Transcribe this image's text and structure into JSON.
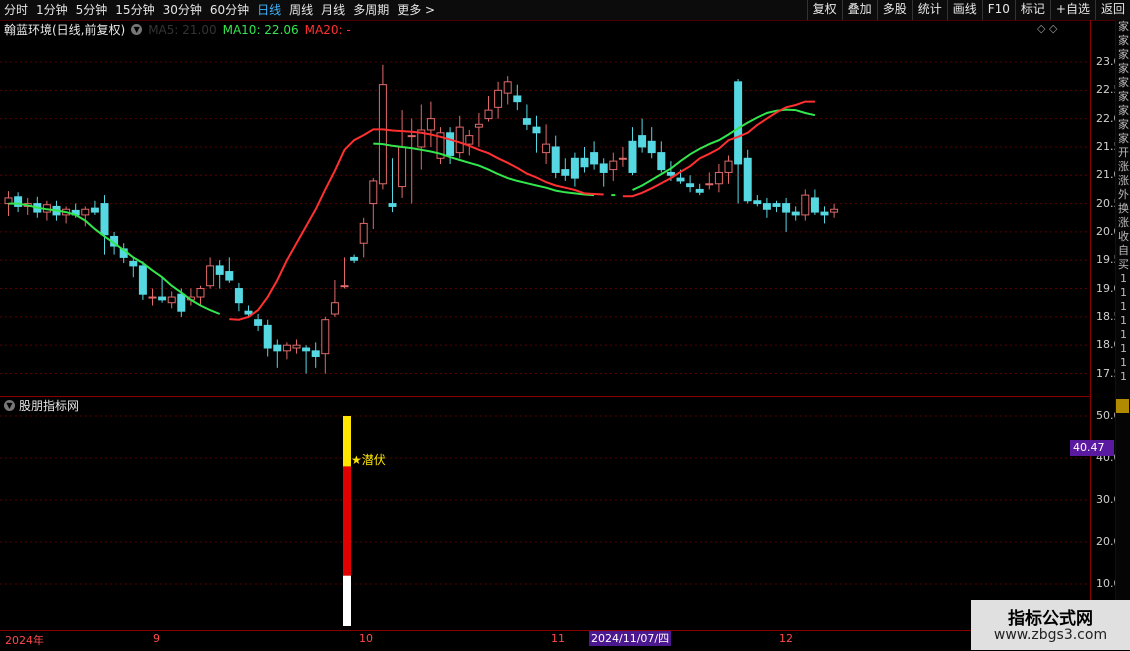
{
  "toolbar": {
    "tabs": [
      "分时",
      "1分钟",
      "5分钟",
      "15分钟",
      "30分钟",
      "60分钟",
      "日线",
      "周线",
      "月线",
      "多周期",
      "更多 >"
    ],
    "active_tab": "日线",
    "right_buttons": [
      "复权",
      "叠加",
      "多股",
      "统计",
      "画线",
      "F10",
      "标记",
      "+自选",
      "返回"
    ]
  },
  "header": {
    "stock_name": "翰蓝环境(日线,前复权)",
    "ma10_label": "MA10: 22.06",
    "ma20_label": "MA20: -",
    "faint_label": "MA5: 21.00"
  },
  "colors": {
    "up": "#e06a6a",
    "down": "#56d8e2",
    "ma10": "#33e64d",
    "ma20": "#ff3030",
    "grid": "#5a0000",
    "axis": "#8a0000",
    "signal": "#ffe600"
  },
  "price_axis": {
    "ticks": [
      "23.00",
      "22.50",
      "22.00",
      "21.50",
      "21.00",
      "20.50",
      "20.00",
      "19.50",
      "19.00",
      "18.50",
      "18.00",
      "17.50"
    ],
    "min": 17.25,
    "max": 23.1
  },
  "indicator": {
    "title": "股朋指标网",
    "ticks": [
      "50.00",
      "40.00",
      "30.00",
      "20.00",
      "10.00"
    ],
    "current_value": "40.47",
    "signal_label": "★潜伏",
    "signal_bar": {
      "segments": [
        {
          "color": "#ffffff",
          "from": 0,
          "to": 12
        },
        {
          "color": "#e00000",
          "from": 12,
          "to": 38
        },
        {
          "color": "#ffe600",
          "from": 38,
          "to": 50
        }
      ]
    }
  },
  "xaxis": {
    "labels": [
      "2024年",
      "9",
      "10",
      "11",
      "12"
    ],
    "cursor_date": "2024/11/07/四"
  },
  "right_strip": [
    "家",
    "家",
    "家",
    "家",
    "家",
    "家",
    "家",
    "家",
    "家",
    "开",
    "涨",
    "涨",
    "外",
    "换",
    "涨",
    "收",
    "自",
    "买",
    "1",
    "1",
    "1",
    "1",
    "1",
    "1",
    "1",
    "1"
  ],
  "watermark": {
    "line1": "指标公式网",
    "line2": "www.zbgs3.com"
  },
  "chart_data": {
    "type": "candlestick",
    "title": "翰蓝环境(日线,前复权)",
    "ylim": [
      17.25,
      23.1
    ],
    "series": [
      {
        "name": "MA10",
        "values": [
          20.5,
          20.5,
          20.47,
          20.43,
          20.4,
          20.38,
          20.35,
          20.3,
          20.2,
          20.05,
          19.92,
          19.8,
          19.68,
          19.55,
          19.45,
          19.32,
          19.2,
          19.05,
          18.93,
          18.8,
          18.7,
          18.62,
          18.55,
          null,
          null,
          null,
          null,
          null,
          null,
          null,
          null,
          null,
          null,
          null,
          null,
          null,
          null,
          null,
          21.56,
          21.55,
          21.52,
          21.5,
          21.48,
          21.45,
          21.42,
          21.38,
          21.32,
          21.27,
          21.22,
          21.17,
          21.1,
          21.02,
          20.95,
          20.9,
          20.86,
          20.82,
          20.78,
          20.73,
          20.7,
          20.68,
          20.66,
          20.65,
          null,
          20.65,
          null,
          20.74,
          20.82,
          20.92,
          21.02,
          21.12,
          21.25,
          21.37,
          21.47,
          21.55,
          21.62,
          21.72,
          21.83,
          21.93,
          22.02,
          22.1,
          22.14,
          22.16,
          22.15,
          22.1,
          22.06
        ]
      },
      {
        "name": "MA20",
        "values": [
          null,
          null,
          null,
          null,
          null,
          null,
          null,
          null,
          null,
          null,
          null,
          null,
          null,
          null,
          null,
          null,
          null,
          null,
          null,
          null,
          null,
          null,
          null,
          18.46,
          18.45,
          18.5,
          18.62,
          18.85,
          19.15,
          19.5,
          19.8,
          20.1,
          20.4,
          20.75,
          21.08,
          21.45,
          21.62,
          21.71,
          21.81,
          21.81,
          21.79,
          21.78,
          21.77,
          21.75,
          21.72,
          21.68,
          21.63,
          21.58,
          21.52,
          21.45,
          21.39,
          21.3,
          21.22,
          21.13,
          21.03,
          20.96,
          20.88,
          20.82,
          20.78,
          20.74,
          20.68,
          20.67,
          20.66,
          null,
          20.63,
          20.63,
          20.69,
          20.77,
          20.86,
          20.95,
          21.06,
          21.16,
          21.3,
          21.38,
          21.47,
          21.62,
          21.68,
          21.75,
          21.89,
          22.0,
          22.11,
          22.2,
          22.24,
          22.3,
          22.3,
          null
        ]
      }
    ],
    "candles": [
      {
        "o": 20.5,
        "h": 20.72,
        "l": 20.28,
        "c": 20.6
      },
      {
        "o": 20.62,
        "h": 20.7,
        "l": 20.35,
        "c": 20.45
      },
      {
        "o": 20.45,
        "h": 20.6,
        "l": 20.3,
        "c": 20.5
      },
      {
        "o": 20.5,
        "h": 20.62,
        "l": 20.25,
        "c": 20.35
      },
      {
        "o": 20.35,
        "h": 20.55,
        "l": 20.2,
        "c": 20.48
      },
      {
        "o": 20.45,
        "h": 20.55,
        "l": 20.2,
        "c": 20.3
      },
      {
        "o": 20.3,
        "h": 20.45,
        "l": 20.15,
        "c": 20.4
      },
      {
        "o": 20.38,
        "h": 20.5,
        "l": 20.25,
        "c": 20.3
      },
      {
        "o": 20.3,
        "h": 20.45,
        "l": 20.1,
        "c": 20.4
      },
      {
        "o": 20.42,
        "h": 20.55,
        "l": 20.3,
        "c": 20.35
      },
      {
        "o": 20.5,
        "h": 20.65,
        "l": 19.6,
        "c": 19.95
      },
      {
        "o": 19.92,
        "h": 20.0,
        "l": 19.6,
        "c": 19.75
      },
      {
        "o": 19.7,
        "h": 19.8,
        "l": 19.45,
        "c": 19.55
      },
      {
        "o": 19.48,
        "h": 19.55,
        "l": 19.2,
        "c": 19.4
      },
      {
        "o": 19.4,
        "h": 19.48,
        "l": 18.8,
        "c": 18.9
      },
      {
        "o": 18.85,
        "h": 19.0,
        "l": 18.7,
        "c": 18.85
      },
      {
        "o": 18.85,
        "h": 19.2,
        "l": 18.75,
        "c": 18.8
      },
      {
        "o": 18.75,
        "h": 18.95,
        "l": 18.65,
        "c": 18.85
      },
      {
        "o": 18.9,
        "h": 19.0,
        "l": 18.5,
        "c": 18.6
      },
      {
        "o": 18.8,
        "h": 19.0,
        "l": 18.7,
        "c": 18.85
      },
      {
        "o": 18.85,
        "h": 19.05,
        "l": 18.7,
        "c": 19.0
      },
      {
        "o": 19.05,
        "h": 19.55,
        "l": 19.0,
        "c": 19.4
      },
      {
        "o": 19.4,
        "h": 19.5,
        "l": 19.0,
        "c": 19.25
      },
      {
        "o": 19.3,
        "h": 19.55,
        "l": 19.1,
        "c": 19.15
      },
      {
        "o": 19.0,
        "h": 19.1,
        "l": 18.6,
        "c": 18.75
      },
      {
        "o": 18.6,
        "h": 18.7,
        "l": 18.5,
        "c": 18.55
      },
      {
        "o": 18.45,
        "h": 18.55,
        "l": 18.25,
        "c": 18.35
      },
      {
        "o": 18.35,
        "h": 18.45,
        "l": 17.8,
        "c": 17.95
      },
      {
        "o": 18.0,
        "h": 18.1,
        "l": 17.6,
        "c": 17.9
      },
      {
        "o": 17.9,
        "h": 18.05,
        "l": 17.75,
        "c": 18.0
      },
      {
        "o": 17.95,
        "h": 18.1,
        "l": 17.85,
        "c": 18.0
      },
      {
        "o": 17.95,
        "h": 18.0,
        "l": 17.5,
        "c": 17.9
      },
      {
        "o": 17.9,
        "h": 18.05,
        "l": 17.6,
        "c": 17.8
      },
      {
        "o": 17.85,
        "h": 18.5,
        "l": 17.5,
        "c": 18.45
      },
      {
        "o": 18.55,
        "h": 19.15,
        "l": 18.5,
        "c": 18.75
      },
      {
        "o": 19.05,
        "h": 19.55,
        "l": 19.0,
        "c": 19.05
      },
      {
        "o": 19.55,
        "h": 19.6,
        "l": 19.45,
        "c": 19.5
      },
      {
        "o": 19.8,
        "h": 20.25,
        "l": 19.55,
        "c": 20.15
      },
      {
        "o": 20.5,
        "h": 20.95,
        "l": 20.05,
        "c": 20.9
      },
      {
        "o": 20.85,
        "h": 22.95,
        "l": 20.75,
        "c": 22.6
      },
      {
        "o": 20.5,
        "h": 21.3,
        "l": 20.35,
        "c": 20.45
      },
      {
        "o": 20.8,
        "h": 22.15,
        "l": 20.6,
        "c": 21.5
      },
      {
        "o": 21.7,
        "h": 22.0,
        "l": 20.5,
        "c": 21.7
      },
      {
        "o": 21.5,
        "h": 22.25,
        "l": 21.1,
        "c": 21.8
      },
      {
        "o": 21.8,
        "h": 22.3,
        "l": 21.5,
        "c": 22.0
      },
      {
        "o": 21.3,
        "h": 21.85,
        "l": 21.2,
        "c": 21.75
      },
      {
        "o": 21.75,
        "h": 21.85,
        "l": 21.2,
        "c": 21.35
      },
      {
        "o": 21.4,
        "h": 22.05,
        "l": 21.3,
        "c": 21.85
      },
      {
        "o": 21.55,
        "h": 21.8,
        "l": 21.35,
        "c": 21.7
      },
      {
        "o": 21.85,
        "h": 22.1,
        "l": 21.5,
        "c": 21.9
      },
      {
        "o": 22.0,
        "h": 22.4,
        "l": 21.95,
        "c": 22.15
      },
      {
        "o": 22.2,
        "h": 22.65,
        "l": 22.0,
        "c": 22.5
      },
      {
        "o": 22.45,
        "h": 22.75,
        "l": 22.25,
        "c": 22.65
      },
      {
        "o": 22.4,
        "h": 22.6,
        "l": 22.15,
        "c": 22.3
      },
      {
        "o": 22.0,
        "h": 22.25,
        "l": 21.8,
        "c": 21.9
      },
      {
        "o": 21.85,
        "h": 22.05,
        "l": 21.4,
        "c": 21.75
      },
      {
        "o": 21.4,
        "h": 21.9,
        "l": 21.2,
        "c": 21.55
      },
      {
        "o": 21.5,
        "h": 21.7,
        "l": 20.95,
        "c": 21.05
      },
      {
        "o": 21.1,
        "h": 21.3,
        "l": 20.9,
        "c": 21.0
      },
      {
        "o": 21.3,
        "h": 21.4,
        "l": 20.8,
        "c": 20.95
      },
      {
        "o": 21.3,
        "h": 21.5,
        "l": 21.05,
        "c": 21.15
      },
      {
        "o": 21.4,
        "h": 21.6,
        "l": 21.1,
        "c": 21.2
      },
      {
        "o": 21.2,
        "h": 21.3,
        "l": 20.8,
        "c": 21.05
      },
      {
        "o": 21.1,
        "h": 21.4,
        "l": 20.9,
        "c": 21.25
      },
      {
        "o": 21.3,
        "h": 21.5,
        "l": 21.15,
        "c": 21.3
      },
      {
        "o": 21.6,
        "h": 21.85,
        "l": 21.0,
        "c": 21.05
      },
      {
        "o": 21.7,
        "h": 22.0,
        "l": 21.4,
        "c": 21.5
      },
      {
        "o": 21.6,
        "h": 21.85,
        "l": 21.3,
        "c": 21.4
      },
      {
        "o": 21.4,
        "h": 21.6,
        "l": 21.05,
        "c": 21.1
      },
      {
        "o": 21.05,
        "h": 21.25,
        "l": 20.9,
        "c": 21.0
      },
      {
        "o": 20.95,
        "h": 21.1,
        "l": 20.85,
        "c": 20.9
      },
      {
        "o": 20.85,
        "h": 21.0,
        "l": 20.7,
        "c": 20.8
      },
      {
        "o": 20.75,
        "h": 20.85,
        "l": 20.65,
        "c": 20.7
      },
      {
        "o": 20.85,
        "h": 21.05,
        "l": 20.75,
        "c": 20.85
      },
      {
        "o": 20.85,
        "h": 21.2,
        "l": 20.7,
        "c": 21.05
      },
      {
        "o": 21.05,
        "h": 21.35,
        "l": 20.85,
        "c": 21.25
      },
      {
        "o": 22.65,
        "h": 22.7,
        "l": 20.5,
        "c": 21.2
      },
      {
        "o": 21.3,
        "h": 21.45,
        "l": 20.5,
        "c": 20.55
      },
      {
        "o": 20.55,
        "h": 20.65,
        "l": 20.45,
        "c": 20.5
      },
      {
        "o": 20.5,
        "h": 20.6,
        "l": 20.25,
        "c": 20.4
      },
      {
        "o": 20.5,
        "h": 20.55,
        "l": 20.35,
        "c": 20.45
      },
      {
        "o": 20.5,
        "h": 20.6,
        "l": 20.0,
        "c": 20.35
      },
      {
        "o": 20.35,
        "h": 20.45,
        "l": 20.2,
        "c": 20.3
      },
      {
        "o": 20.3,
        "h": 20.75,
        "l": 20.2,
        "c": 20.65
      },
      {
        "o": 20.6,
        "h": 20.75,
        "l": 20.3,
        "c": 20.35
      },
      {
        "o": 20.35,
        "h": 20.45,
        "l": 20.15,
        "c": 20.3
      },
      {
        "o": 20.35,
        "h": 20.5,
        "l": 20.25,
        "c": 20.4
      }
    ]
  }
}
